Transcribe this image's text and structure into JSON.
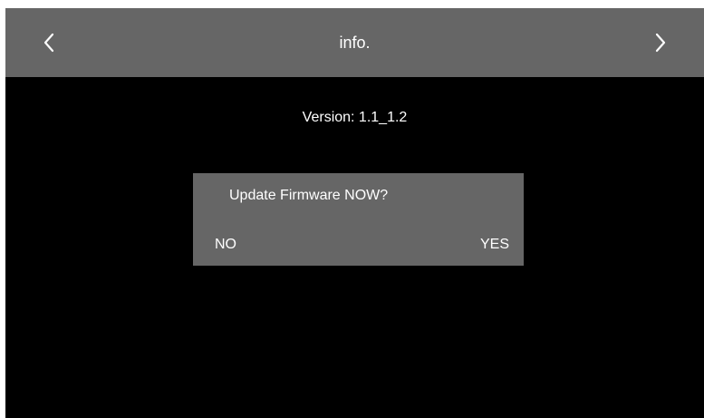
{
  "header": {
    "title": "info.",
    "back_icon": "chevron-left-icon",
    "forward_icon": "chevron-right-icon"
  },
  "main": {
    "version_text": "Version: 1.1_1.2"
  },
  "dialog": {
    "message": "Update Firmware NOW?",
    "no_label": "NO",
    "yes_label": "YES"
  },
  "colors": {
    "background": "#000000",
    "bar": "#666666",
    "text": "#ffffff"
  }
}
